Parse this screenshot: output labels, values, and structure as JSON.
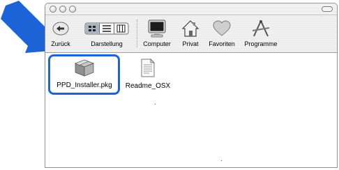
{
  "window": {
    "toolbar": {
      "items": [
        {
          "label": "Zurück",
          "icon": "back-arrow-icon"
        },
        {
          "label": "Darstellung",
          "icon": "view-mode-icon"
        },
        {
          "label": "Computer",
          "icon": "computer-monitor-icon"
        },
        {
          "label": "Privat",
          "icon": "home-house-icon"
        },
        {
          "label": "Favoriten",
          "icon": "heart-icon"
        },
        {
          "label": "Programme",
          "icon": "applications-icon"
        }
      ]
    },
    "files": [
      {
        "name": "PPD_Installer.pkg",
        "icon": "package-box-icon",
        "highlighted": true
      },
      {
        "name": "Readme_OSX",
        "icon": "text-document-icon",
        "highlighted": false
      }
    ]
  },
  "annotation": {
    "arrow_color": "#1d63d8",
    "highlight_color": "#1d63d8"
  }
}
